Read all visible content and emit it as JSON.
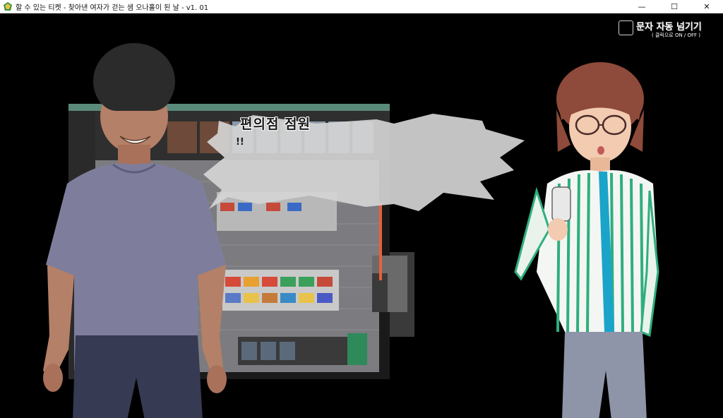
{
  "window": {
    "title": "할 수 있는 티켓 - 찾아낸 여자가 걷는 샘 오나홀이 된 날 - v1. 01",
    "controls": {
      "minimize": "—",
      "maximize": "☐",
      "close": "✕"
    }
  },
  "dialogue": {
    "speaker": "편의점 점원",
    "text": "!!"
  },
  "auto_advance": {
    "label": "문자 자동 넘기기",
    "hint": "( 클릭으로 ON / OFF )",
    "checked": false
  },
  "icons": {
    "app": "game-app-icon",
    "checkbox": "checkbox-icon"
  },
  "colors": {
    "background": "#000000",
    "bubble_fill": "#d4d4d4",
    "uniform_stripe": "#2fae7e",
    "uniform_accent": "#1ba4c9"
  }
}
